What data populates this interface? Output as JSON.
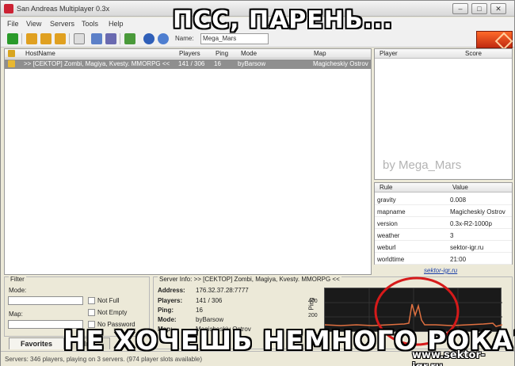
{
  "window": {
    "title": "San Andreas Multiplayer 0.3x",
    "min": "–",
    "max": "□",
    "close": "✕"
  },
  "menu": [
    "File",
    "View",
    "Servers",
    "Tools",
    "Help"
  ],
  "toolbar": {
    "name_label": "Name:",
    "name_value": "Mega_Mars"
  },
  "server_list": {
    "columns": [
      "HostName",
      "Players",
      "Ping",
      "Mode",
      "Map"
    ],
    "rows": [
      {
        "hostname": ">> [CEKTOP] Zombi, Magiya, Kvesty. MMORPG <<",
        "players": "141 / 306",
        "ping": "16",
        "mode": "byBarsow",
        "map": "Magicheskiy Ostrov"
      }
    ]
  },
  "players_panel": {
    "col_player": "Player",
    "col_score": "Score",
    "watermark": "by Mega_Mars"
  },
  "rules_panel": {
    "col_rule": "Rule",
    "col_value": "Value",
    "rows": [
      {
        "rule": "gravity",
        "value": "0.008"
      },
      {
        "rule": "mapname",
        "value": "Magicheskiy Ostrov"
      },
      {
        "rule": "version",
        "value": "0.3x-R2-1000p"
      },
      {
        "rule": "weather",
        "value": "3"
      },
      {
        "rule": "weburl",
        "value": "sektor-igr.ru"
      },
      {
        "rule": "worldtime",
        "value": "21:00"
      }
    ],
    "link": "sektor-igr.ru"
  },
  "filter": {
    "title": "Filter",
    "mode_label": "Mode:",
    "map_label": "Map:",
    "not_full": "Not Full",
    "not_empty": "Not Empty",
    "no_password": "No Password"
  },
  "tabs": [
    "Favorites",
    "Int"
  ],
  "server_info": {
    "title": "Server Info: >> [CEKTOP] Zombi, Magiya, Kvesty. MMORPG <<",
    "address_label": "Address:",
    "address": "176.32.37.28:7777",
    "players_label": "Players:",
    "players": "141 / 306",
    "ping_label": "Ping:",
    "ping": "16",
    "mode_label": "Mode:",
    "mode": "byBarsow",
    "map_label": "Map:",
    "map": "Magicheskiy Ostrov"
  },
  "ping_graph": {
    "axis_label": "Ping",
    "ticks": [
      "400",
      "200"
    ]
  },
  "status": "Servers: 346 players, playing on 3 servers. (974 player slots available)",
  "meme": {
    "top": "ПСС, ПАРЕНЬ...",
    "bottom": "НЕ ХОЧЕШЬ НЕМНОГО РОКА?"
  },
  "site_watermark": "www.sektor-igr.ru"
}
